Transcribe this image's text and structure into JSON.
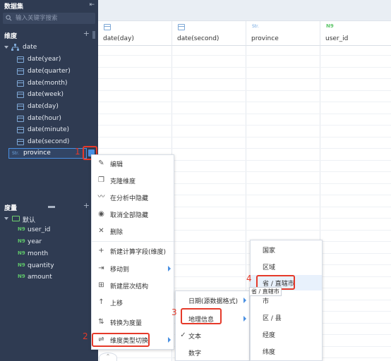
{
  "sidebar": {
    "title": "数据集",
    "collapse_icon": "collapse-icon",
    "search_placeholder": "输入关键字搜索",
    "dimension_section": "维度",
    "date_group": "date",
    "date_fields": [
      "date(year)",
      "date(quarter)",
      "date(month)",
      "date(week)",
      "date(day)",
      "date(hour)",
      "date(minute)",
      "date(second)"
    ],
    "province_type": "Str.",
    "province_label": "province",
    "measure_section": "度量",
    "default_folder": "默认",
    "measure_type": "N9",
    "measures": [
      "user_id",
      "year",
      "month",
      "quantity",
      "amount"
    ]
  },
  "grid": {
    "columns": [
      {
        "type": "date-icon",
        "name": "date(day)"
      },
      {
        "type": "date-icon",
        "name": "date(second)"
      },
      {
        "type": "Str.",
        "name": "province"
      },
      {
        "type": "N9",
        "name": "user_id"
      }
    ]
  },
  "annotations": {
    "step1": "1",
    "step2": "2",
    "step3": "3",
    "step4": "4"
  },
  "context_menu": {
    "items": [
      {
        "icon": "edit-icon",
        "label": "编辑"
      },
      {
        "icon": "clone-icon",
        "label": "克隆维度"
      },
      {
        "icon": "hide-icon",
        "label": "在分析中隐藏"
      },
      {
        "icon": "eye-icon",
        "label": "取消全部隐藏"
      },
      {
        "icon": "delete-icon",
        "label": "删除"
      },
      {
        "icon": "plus-icon",
        "label": "新建计算字段(维度)"
      },
      {
        "icon": "move-icon",
        "label": "移动到"
      },
      {
        "icon": "hierarchy-icon",
        "label": "新建层次结构"
      },
      {
        "icon": "arrow-up-icon",
        "label": "上移"
      },
      {
        "icon": "convert-icon",
        "label": "转换为度量"
      },
      {
        "icon": "switch-icon",
        "label": "维度类型切换"
      }
    ]
  },
  "type_submenu": {
    "items": [
      {
        "label": "日期(源数据格式)",
        "has_sub": true
      },
      {
        "label": "地理信息",
        "has_sub": true
      },
      {
        "label": "文本",
        "checked": true
      },
      {
        "label": "数字"
      }
    ]
  },
  "geo_submenu": {
    "items": [
      "国家",
      "区域",
      "省 / 直辖市",
      "市",
      "区 / 县",
      "经度",
      "纬度"
    ],
    "tooltip": "省 / 直辖市"
  }
}
